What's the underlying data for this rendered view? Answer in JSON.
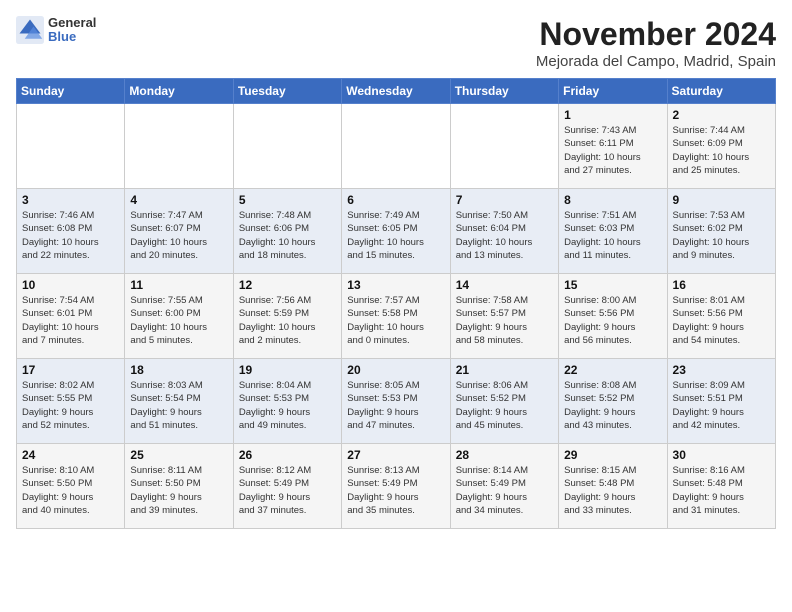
{
  "logo": {
    "general": "General",
    "blue": "Blue"
  },
  "title": "November 2024",
  "location": "Mejorada del Campo, Madrid, Spain",
  "weekdays": [
    "Sunday",
    "Monday",
    "Tuesday",
    "Wednesday",
    "Thursday",
    "Friday",
    "Saturday"
  ],
  "weeks": [
    [
      {
        "day": "",
        "info": ""
      },
      {
        "day": "",
        "info": ""
      },
      {
        "day": "",
        "info": ""
      },
      {
        "day": "",
        "info": ""
      },
      {
        "day": "",
        "info": ""
      },
      {
        "day": "1",
        "info": "Sunrise: 7:43 AM\nSunset: 6:11 PM\nDaylight: 10 hours\nand 27 minutes."
      },
      {
        "day": "2",
        "info": "Sunrise: 7:44 AM\nSunset: 6:09 PM\nDaylight: 10 hours\nand 25 minutes."
      }
    ],
    [
      {
        "day": "3",
        "info": "Sunrise: 7:46 AM\nSunset: 6:08 PM\nDaylight: 10 hours\nand 22 minutes."
      },
      {
        "day": "4",
        "info": "Sunrise: 7:47 AM\nSunset: 6:07 PM\nDaylight: 10 hours\nand 20 minutes."
      },
      {
        "day": "5",
        "info": "Sunrise: 7:48 AM\nSunset: 6:06 PM\nDaylight: 10 hours\nand 18 minutes."
      },
      {
        "day": "6",
        "info": "Sunrise: 7:49 AM\nSunset: 6:05 PM\nDaylight: 10 hours\nand 15 minutes."
      },
      {
        "day": "7",
        "info": "Sunrise: 7:50 AM\nSunset: 6:04 PM\nDaylight: 10 hours\nand 13 minutes."
      },
      {
        "day": "8",
        "info": "Sunrise: 7:51 AM\nSunset: 6:03 PM\nDaylight: 10 hours\nand 11 minutes."
      },
      {
        "day": "9",
        "info": "Sunrise: 7:53 AM\nSunset: 6:02 PM\nDaylight: 10 hours\nand 9 minutes."
      }
    ],
    [
      {
        "day": "10",
        "info": "Sunrise: 7:54 AM\nSunset: 6:01 PM\nDaylight: 10 hours\nand 7 minutes."
      },
      {
        "day": "11",
        "info": "Sunrise: 7:55 AM\nSunset: 6:00 PM\nDaylight: 10 hours\nand 5 minutes."
      },
      {
        "day": "12",
        "info": "Sunrise: 7:56 AM\nSunset: 5:59 PM\nDaylight: 10 hours\nand 2 minutes."
      },
      {
        "day": "13",
        "info": "Sunrise: 7:57 AM\nSunset: 5:58 PM\nDaylight: 10 hours\nand 0 minutes."
      },
      {
        "day": "14",
        "info": "Sunrise: 7:58 AM\nSunset: 5:57 PM\nDaylight: 9 hours\nand 58 minutes."
      },
      {
        "day": "15",
        "info": "Sunrise: 8:00 AM\nSunset: 5:56 PM\nDaylight: 9 hours\nand 56 minutes."
      },
      {
        "day": "16",
        "info": "Sunrise: 8:01 AM\nSunset: 5:56 PM\nDaylight: 9 hours\nand 54 minutes."
      }
    ],
    [
      {
        "day": "17",
        "info": "Sunrise: 8:02 AM\nSunset: 5:55 PM\nDaylight: 9 hours\nand 52 minutes."
      },
      {
        "day": "18",
        "info": "Sunrise: 8:03 AM\nSunset: 5:54 PM\nDaylight: 9 hours\nand 51 minutes."
      },
      {
        "day": "19",
        "info": "Sunrise: 8:04 AM\nSunset: 5:53 PM\nDaylight: 9 hours\nand 49 minutes."
      },
      {
        "day": "20",
        "info": "Sunrise: 8:05 AM\nSunset: 5:53 PM\nDaylight: 9 hours\nand 47 minutes."
      },
      {
        "day": "21",
        "info": "Sunrise: 8:06 AM\nSunset: 5:52 PM\nDaylight: 9 hours\nand 45 minutes."
      },
      {
        "day": "22",
        "info": "Sunrise: 8:08 AM\nSunset: 5:52 PM\nDaylight: 9 hours\nand 43 minutes."
      },
      {
        "day": "23",
        "info": "Sunrise: 8:09 AM\nSunset: 5:51 PM\nDaylight: 9 hours\nand 42 minutes."
      }
    ],
    [
      {
        "day": "24",
        "info": "Sunrise: 8:10 AM\nSunset: 5:50 PM\nDaylight: 9 hours\nand 40 minutes."
      },
      {
        "day": "25",
        "info": "Sunrise: 8:11 AM\nSunset: 5:50 PM\nDaylight: 9 hours\nand 39 minutes."
      },
      {
        "day": "26",
        "info": "Sunrise: 8:12 AM\nSunset: 5:49 PM\nDaylight: 9 hours\nand 37 minutes."
      },
      {
        "day": "27",
        "info": "Sunrise: 8:13 AM\nSunset: 5:49 PM\nDaylight: 9 hours\nand 35 minutes."
      },
      {
        "day": "28",
        "info": "Sunrise: 8:14 AM\nSunset: 5:49 PM\nDaylight: 9 hours\nand 34 minutes."
      },
      {
        "day": "29",
        "info": "Sunrise: 8:15 AM\nSunset: 5:48 PM\nDaylight: 9 hours\nand 33 minutes."
      },
      {
        "day": "30",
        "info": "Sunrise: 8:16 AM\nSunset: 5:48 PM\nDaylight: 9 hours\nand 31 minutes."
      }
    ]
  ]
}
